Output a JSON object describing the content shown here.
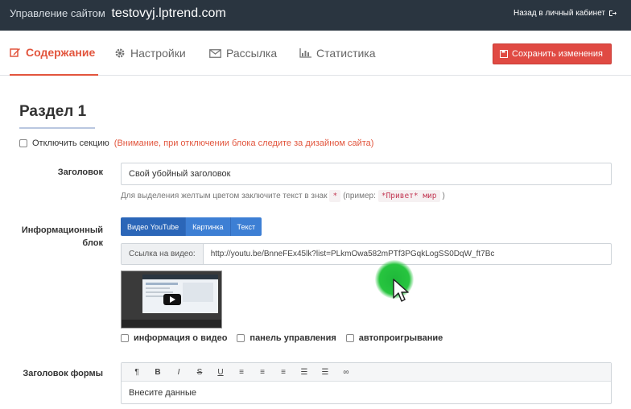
{
  "topbar": {
    "prefix": "Управление сайтом",
    "site": "testovyj.lptrend.com",
    "back_label": "Назад в личный кабинет"
  },
  "tabs": [
    {
      "label": "Содержание",
      "icon": "edit-icon",
      "active": true
    },
    {
      "label": "Настройки",
      "icon": "gear-icon",
      "active": false
    },
    {
      "label": "Рассылка",
      "icon": "envelope-icon",
      "active": false
    },
    {
      "label": "Статистика",
      "icon": "bar-chart-icon",
      "active": false
    }
  ],
  "save_button": {
    "label": "Сохранить изменения",
    "icon": "save-icon"
  },
  "section": {
    "title": "Раздел 1",
    "disable_label": "Отключить секцию",
    "disable_warning": "(Внимание, при отключении блока следите за дизайном сайта)"
  },
  "heading": {
    "label": "Заголовок",
    "value": "Свой убойный заголовок",
    "hint_prefix": "Для выделения желтым цветом заключите текст в знак",
    "hint_symbol": "*",
    "hint_example_open": "(пример:",
    "hint_example_code": "*Привет* мир",
    "hint_example_close": ")"
  },
  "info_block": {
    "label_line1": "Информационный",
    "label_line2": "блок",
    "tabs": [
      "Видео YouTube",
      "Картинка",
      "Текст"
    ],
    "video_addon": "Ссылка на видео:",
    "video_url": "http://youtu.be/BnneFEx45lk?list=PLkmOwa582mPTf3PGqkLogSS0DqW_ft7Bc",
    "options": [
      "информация о видео",
      "панель управления",
      "автопроигрывание"
    ]
  },
  "form_heading": {
    "label": "Заголовок формы",
    "toolbar": [
      {
        "icon": "paragraph-icon",
        "glyph": "¶"
      },
      {
        "icon": "bold-icon",
        "glyph": "B"
      },
      {
        "icon": "italic-icon",
        "glyph": "I"
      },
      {
        "icon": "strikethrough-icon",
        "glyph": "S"
      },
      {
        "icon": "underline-icon",
        "glyph": "U"
      },
      {
        "icon": "align-left-icon",
        "glyph": "≡"
      },
      {
        "icon": "align-center-icon",
        "glyph": "≡"
      },
      {
        "icon": "align-right-icon",
        "glyph": "≡"
      },
      {
        "icon": "ordered-list-icon",
        "glyph": "☰"
      },
      {
        "icon": "unordered-list-icon",
        "glyph": "☰"
      },
      {
        "icon": "link-icon",
        "glyph": "∞"
      }
    ],
    "value": "Внесите данные"
  },
  "colors": {
    "accent": "#e2553d",
    "topbar": "#2a3540",
    "primary": "#3d7fd4",
    "save": "#e04a43",
    "cursor_highlight": "#27c53f"
  }
}
